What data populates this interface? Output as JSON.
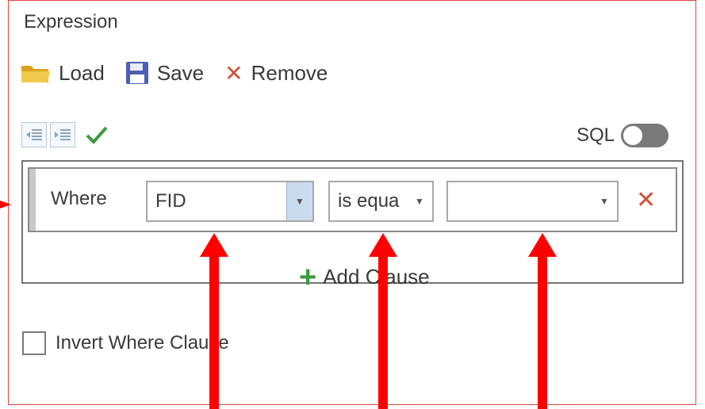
{
  "panel": {
    "title": "Expression"
  },
  "toolbar": {
    "load_label": "Load",
    "save_label": "Save",
    "remove_label": "Remove"
  },
  "sql": {
    "label": "SQL",
    "enabled": false
  },
  "clause": {
    "where_label": "Where",
    "field_value": "FID",
    "operator_value": "is equa",
    "value_value": ""
  },
  "add_clause_label": "Add Clause",
  "invert": {
    "label": "Invert Where Clause",
    "checked": false
  },
  "colors": {
    "panel_border": "#e0463c",
    "annotation_arrow": "#ff0000",
    "remove_x": "#d0503a",
    "check": "#3c9a3c",
    "add_plus": "#3c9a3c"
  }
}
